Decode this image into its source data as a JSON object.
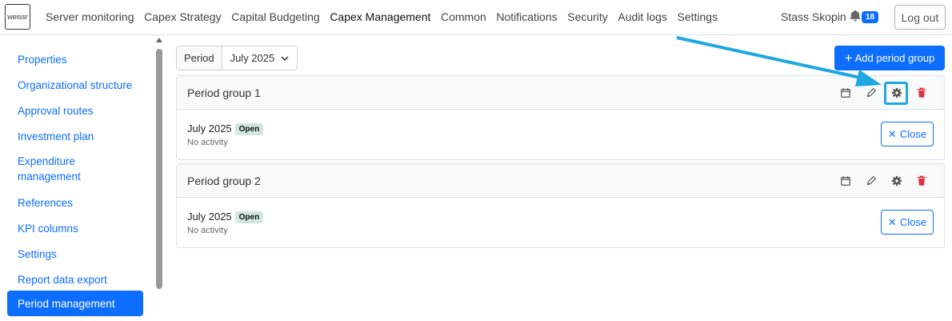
{
  "app": {
    "logo_text": "weissr"
  },
  "nav": {
    "items": [
      "Server monitoring",
      "Capex Strategy",
      "Capital Budgeting",
      "Capex Management",
      "Common",
      "Notifications",
      "Security",
      "Audit logs",
      "Settings"
    ],
    "active": "Capex Management",
    "user_name": "Stass Skopin",
    "notification_count": "18",
    "logout_label": "Log out"
  },
  "sidebar": {
    "items": [
      "Properties",
      "Organizational structure",
      "Approval routes",
      "Investment plan",
      "Expenditure management",
      "References",
      "KPI columns",
      "Settings",
      "Report data export",
      "Period management"
    ],
    "active": "Period management"
  },
  "toolbar": {
    "period_label": "Period",
    "period_value": "July 2025",
    "add_label": "Add period group"
  },
  "groups": [
    {
      "title": "Period group 1",
      "period": "July 2025",
      "status": "Open",
      "activity": "No activity",
      "close_label": "Close"
    },
    {
      "title": "Period group 2",
      "period": "July 2025",
      "status": "Open",
      "activity": "No activity",
      "close_label": "Close"
    }
  ],
  "colors": {
    "accent": "#0d6efd",
    "danger": "#dc3545",
    "annotation": "#1ea7e0",
    "status_bg": "#d1e7dd"
  },
  "icons": [
    "calendar-icon",
    "pencil-icon",
    "gear-icon",
    "trash-icon",
    "bell-icon",
    "plus-icon",
    "x-icon",
    "chevron-down-icon"
  ]
}
